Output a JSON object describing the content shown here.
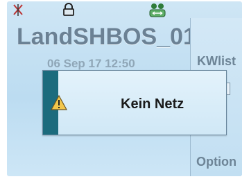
{
  "screen": {
    "title": "LandSHBOS_01",
    "date_fragment": "06 Sep 17 12:50"
  },
  "softkeys": {
    "top": "KWlist",
    "bottom": "Option"
  },
  "dialog": {
    "message": "Kein Netz",
    "icon": "warning-icon"
  },
  "status_icons": [
    "no-signal-icon",
    "lock-icon",
    "group-call-icon"
  ],
  "colors": {
    "accent": "#1c6b7d",
    "screen_bg": "#c6e1f3",
    "title_text": "#6b8194"
  }
}
